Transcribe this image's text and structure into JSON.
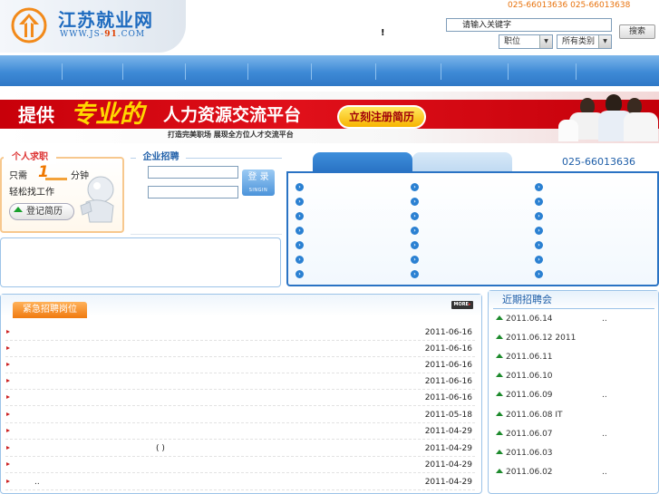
{
  "header": {
    "logo_cn": "江苏就业网",
    "logo_en_pre": "WWW.JS-",
    "logo_en_num": "91",
    "logo_en_post": ".COM",
    "phones": "025-66013636 025-66013638",
    "exclaim": "!",
    "search_value": "请输入关键字",
    "search_button": "搜索",
    "select_1": "职位",
    "select_2": "所有类别"
  },
  "banner": {
    "text_1": "提供",
    "text_big": "专业的",
    "text_2": "人力资源交流平台",
    "sub": "打造完美职场   展现全方位人才交流平台",
    "button": "立刻注册简历"
  },
  "personal": {
    "title": "个人求职",
    "line1_a": "只需",
    "line1_num": "1",
    "line1_b": "分钟",
    "line2": "轻松找工作",
    "register": "登记简历"
  },
  "company": {
    "title": "企业招聘",
    "login_cn": "登 录",
    "login_en": "SINGIN"
  },
  "links": {
    "phone": "025-66013636"
  },
  "urgent": {
    "title": "紧急招聘岗位",
    "more": "MORE",
    "rows": [
      {
        "text": "",
        "date": "2011-06-16"
      },
      {
        "text": "",
        "date": "2011-06-16"
      },
      {
        "text": "",
        "date": "2011-06-16"
      },
      {
        "text": "",
        "date": "2011-06-16"
      },
      {
        "text": "",
        "date": "2011-06-16"
      },
      {
        "text": "",
        "date": "2011-05-18"
      },
      {
        "text": "",
        "date": "2011-04-29"
      },
      {
        "text": "( )",
        "date": "2011-04-29"
      },
      {
        "text": "",
        "date": "2011-04-29"
      },
      {
        "text": "..",
        "date": "2011-04-29"
      }
    ]
  },
  "fairs": {
    "title": "近期招聘会",
    "rows": [
      {
        "date": "2011.06.14",
        "suffix": ".."
      },
      {
        "date": "2011.06.12 2011",
        "suffix": ""
      },
      {
        "date": "2011.06.11",
        "suffix": ""
      },
      {
        "date": "2011.06.10",
        "suffix": ""
      },
      {
        "date": "2011.06.09",
        "suffix": ".."
      },
      {
        "date": "2011.06.08 IT",
        "suffix": ""
      },
      {
        "date": "2011.06.07",
        "suffix": ".."
      },
      {
        "date": "2011.06.03",
        "suffix": ""
      },
      {
        "date": "2011.06.02",
        "suffix": ".."
      }
    ]
  }
}
